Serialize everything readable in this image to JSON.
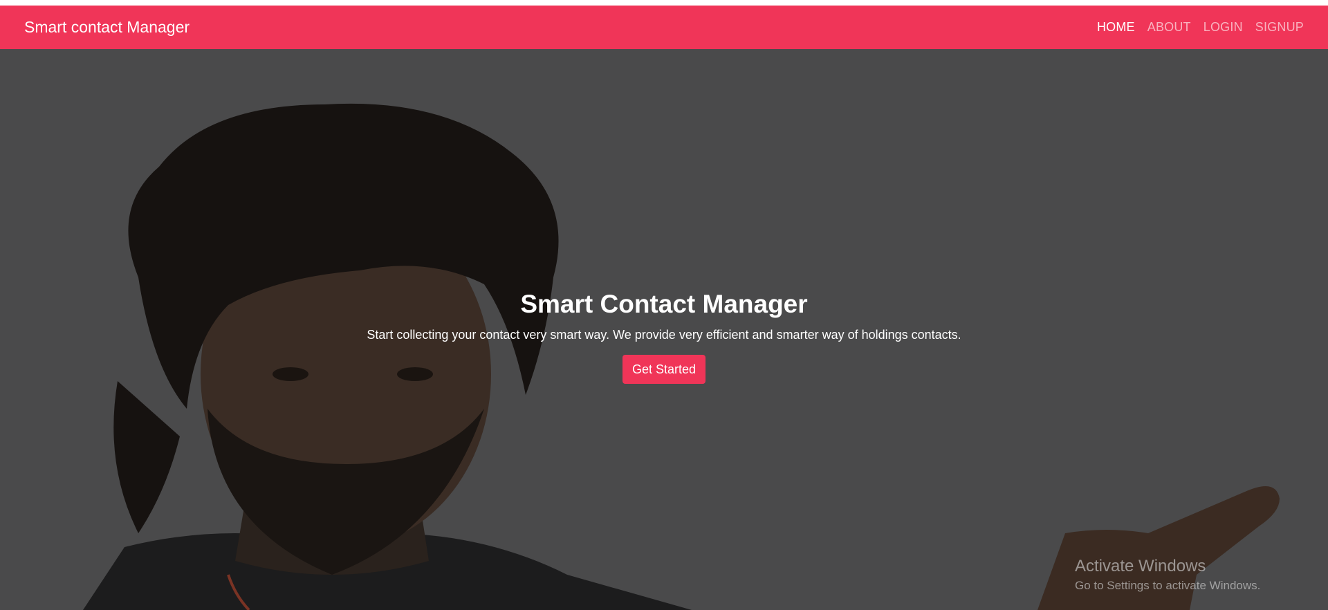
{
  "navbar": {
    "brand": "Smart contact Manager",
    "links": [
      {
        "label": "HOME",
        "active": true
      },
      {
        "label": "ABOUT",
        "active": false
      },
      {
        "label": "LOGIN",
        "active": false
      },
      {
        "label": "SIGNUP",
        "active": false
      }
    ]
  },
  "hero": {
    "title": "Smart Contact Manager",
    "subtitle": "Start collecting your contact very smart way. We provide very efficient and smarter way of holdings contacts.",
    "cta_label": "Get Started"
  },
  "watermark": {
    "title": "Activate Windows",
    "subtitle": "Go to Settings to activate Windows."
  },
  "colors": {
    "brand": "#f03558",
    "hero_overlay": "#4a4a4b"
  }
}
